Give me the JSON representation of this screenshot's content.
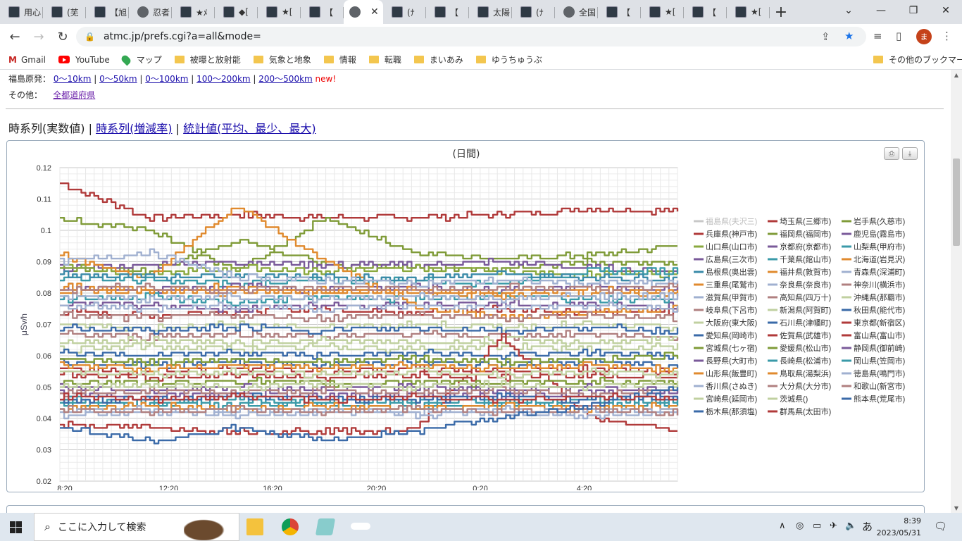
{
  "browser": {
    "tabs": [
      {
        "label": "用心",
        "icon": "ms-icon"
      },
      {
        "label": "(芜",
        "icon": "ms-icon"
      },
      {
        "label": "【旭",
        "icon": "ms-icon"
      },
      {
        "label": "忍者",
        "icon": "globe-icon"
      },
      {
        "label": "★ﾒ",
        "icon": "ms-icon"
      },
      {
        "label": "◆[",
        "icon": "ms-icon"
      },
      {
        "label": "★[",
        "icon": "ms-icon"
      },
      {
        "label": "【",
        "icon": "ms-icon"
      },
      {
        "label": "",
        "icon": "globe-icon",
        "active": true
      },
      {
        "label": "(ﾅ",
        "icon": "ms-icon"
      },
      {
        "label": "【",
        "icon": "ms-icon"
      },
      {
        "label": "太陽",
        "icon": "ms-icon"
      },
      {
        "label": "(ﾅ",
        "icon": "ms-icon"
      },
      {
        "label": "全国",
        "icon": "globe-icon"
      },
      {
        "label": "【",
        "icon": "ms-icon"
      },
      {
        "label": "★[",
        "icon": "ms-icon"
      },
      {
        "label": "【",
        "icon": "ms-icon"
      },
      {
        "label": "★[",
        "icon": "ms-icon"
      }
    ],
    "url": "atmc.jp/prefs.cgi?a=all&mode=",
    "profile_initial": "ま",
    "bookmarks": [
      "Gmail",
      "YouTube",
      "マップ",
      "被曝と放射能",
      "気象と地象",
      "情報",
      "転職",
      "まいあみ",
      "ゆうちゅうぶ"
    ],
    "other_bookmarks": "その他のブックマーク"
  },
  "page": {
    "fukushima_label": "福島原発：",
    "fukushima_links": [
      "0～10km",
      "0～50km",
      "0～100km",
      "100～200km",
      "200～500km"
    ],
    "new_label": "new!",
    "other_label": "その他：",
    "other_link": "全都道府県",
    "view_current": "時系列(実数値)",
    "view_links": [
      "時系列(増減率)",
      "統計値(平均、最少、最大)"
    ]
  },
  "chart_data": {
    "type": "line",
    "title": "(日間)",
    "ylabel": "μSv/h",
    "ylim": [
      0.02,
      0.12
    ],
    "yticks": [
      "0.02",
      "0.03",
      "0.04",
      "0.05",
      "0.06",
      "0.07",
      "0.08",
      "0.09",
      "0.1",
      "0.11",
      "0.12"
    ],
    "x": [
      "8:20",
      "12:20",
      "16:20",
      "20:20",
      "0:20",
      "4:20"
    ],
    "series": [
      {
        "name": "福島県(夫沢三)",
        "color": "#c8c8c8",
        "values": []
      },
      {
        "name": "埼玉県(三郷市)",
        "color": "#b03a3a",
        "values": [
          0.115,
          0.104,
          0.105,
          0.104,
          0.104,
          0.105,
          0.107,
          0.106
        ]
      },
      {
        "name": "岩手県(久慈市)",
        "color": "#7f9b38",
        "values": [
          0.104,
          0.1,
          0.087,
          0.104,
          0.093,
          0.091,
          0.092,
          0.095
        ]
      },
      {
        "name": "兵庫県(神戸市)",
        "color": "#b03a3a",
        "values": [
          0.074,
          0.073,
          0.074,
          0.075,
          0.074,
          0.075,
          0.074,
          0.074
        ]
      },
      {
        "name": "福岡県(福岡市)",
        "color": "#7f9b38",
        "values": [
          0.088,
          0.087,
          0.097,
          0.089,
          0.088,
          0.088,
          0.09,
          0.089
        ]
      },
      {
        "name": "鹿児島(霧島市)",
        "color": "#7a5a9a",
        "values": [
          0.088,
          0.089,
          0.09,
          0.089,
          0.089,
          0.09,
          0.088,
          0.087
        ]
      },
      {
        "name": "山口県(山口市)",
        "color": "#8aa83e",
        "values": [
          0.089,
          0.086,
          0.088,
          0.087,
          0.088,
          0.087,
          0.086,
          0.086
        ]
      },
      {
        "name": "京都府(京都市)",
        "color": "#7a5a9a",
        "values": [
          0.077,
          0.076,
          0.075,
          0.076,
          0.076,
          0.077,
          0.076,
          0.076
        ]
      },
      {
        "name": "山梨県(甲府市)",
        "color": "#3a9aa8",
        "values": [
          0.085,
          0.084,
          0.083,
          0.084,
          0.084,
          0.083,
          0.087,
          0.087
        ]
      },
      {
        "name": "広島県(三次市)",
        "color": "#7a5a9a",
        "values": [
          0.082,
          0.081,
          0.082,
          0.081,
          0.082,
          0.081,
          0.082,
          0.081
        ]
      },
      {
        "name": "千葉県(館山市)",
        "color": "#3a9aa8",
        "values": [
          0.078,
          0.079,
          0.077,
          0.079,
          0.078,
          0.079,
          0.078,
          0.078
        ]
      },
      {
        "name": "北海道(岩見沢)",
        "color": "#e08a2e",
        "values": [
          0.092,
          0.085,
          0.108,
          0.09,
          0.076,
          0.072,
          0.074,
          0.075
        ]
      },
      {
        "name": "島根県(奥出雲)",
        "color": "#3a8aa8",
        "values": [
          0.086,
          0.085,
          0.086,
          0.085,
          0.085,
          0.086,
          0.085,
          0.085
        ]
      },
      {
        "name": "福井県(敦賀市)",
        "color": "#e08a2e",
        "values": [
          0.082,
          0.081,
          0.082,
          0.08,
          0.081,
          0.08,
          0.081,
          0.08
        ]
      },
      {
        "name": "青森県(深浦町)",
        "color": "#a0b0d0",
        "values": [
          0.09,
          0.093,
          0.085,
          0.084,
          0.083,
          0.084,
          0.083,
          0.083
        ]
      },
      {
        "name": "三重県(尾鷲市)",
        "color": "#e08a2e",
        "values": [
          0.08,
          0.081,
          0.08,
          0.081,
          0.08,
          0.079,
          0.08,
          0.08
        ]
      },
      {
        "name": "奈良県(奈良市)",
        "color": "#a0b0d0",
        "values": [
          0.079,
          0.078,
          0.079,
          0.078,
          0.079,
          0.078,
          0.079,
          0.079
        ]
      },
      {
        "name": "神奈川(横浜市)",
        "color": "#b08080",
        "values": [
          0.081,
          0.082,
          0.081,
          0.082,
          0.081,
          0.082,
          0.081,
          0.082
        ]
      },
      {
        "name": "滋賀県(甲賀市)",
        "color": "#a0b0d0",
        "values": [
          0.076,
          0.075,
          0.076,
          0.075,
          0.076,
          0.075,
          0.076,
          0.075
        ]
      },
      {
        "name": "高知県(四万十)",
        "color": "#b08080",
        "values": [
          0.073,
          0.072,
          0.073,
          0.072,
          0.073,
          0.072,
          0.073,
          0.072
        ]
      },
      {
        "name": "沖縄県(那覇市)",
        "color": "#c0d0a0",
        "values": [
          0.07,
          0.069,
          0.07,
          0.069,
          0.07,
          0.069,
          0.07,
          0.069
        ]
      },
      {
        "name": "岐阜県(下呂市)",
        "color": "#b08080",
        "values": [
          0.067,
          0.066,
          0.067,
          0.066,
          0.067,
          0.066,
          0.067,
          0.066
        ]
      },
      {
        "name": "新潟県(阿賀町)",
        "color": "#c0d0a0",
        "values": [
          0.064,
          0.065,
          0.064,
          0.065,
          0.064,
          0.065,
          0.064,
          0.065
        ]
      },
      {
        "name": "秋田県(能代市)",
        "color": "#3a6aa8",
        "values": [
          0.069,
          0.068,
          0.069,
          0.068,
          0.069,
          0.068,
          0.069,
          0.068
        ]
      },
      {
        "name": "大阪府(東大阪)",
        "color": "#c0d0a0",
        "values": [
          0.062,
          0.063,
          0.062,
          0.063,
          0.062,
          0.063,
          0.062,
          0.063
        ]
      },
      {
        "name": "石川県(津幡町)",
        "color": "#3a6aa8",
        "values": [
          0.061,
          0.06,
          0.061,
          0.06,
          0.061,
          0.06,
          0.061,
          0.06
        ]
      },
      {
        "name": "東京都(新宿区)",
        "color": "#b03a3a",
        "values": [
          0.038,
          0.037,
          0.036,
          0.036,
          0.036,
          0.066,
          0.04,
          0.036
        ]
      },
      {
        "name": "愛知県(岡崎市)",
        "color": "#3a6aa8",
        "values": [
          0.058,
          0.057,
          0.058,
          0.057,
          0.058,
          0.057,
          0.058,
          0.057
        ]
      },
      {
        "name": "佐賀県(武雄市)",
        "color": "#b03a3a",
        "values": [
          0.056,
          0.055,
          0.056,
          0.055,
          0.056,
          0.055,
          0.056,
          0.055
        ]
      },
      {
        "name": "富山県(富山市)",
        "color": "#b03a3a",
        "values": [
          0.054,
          0.053,
          0.054,
          0.053,
          0.054,
          0.053,
          0.054,
          0.053
        ]
      },
      {
        "name": "宮城県(七ヶ宿)",
        "color": "#7f9b38",
        "values": [
          0.059,
          0.058,
          0.059,
          0.058,
          0.059,
          0.058,
          0.059,
          0.06
        ]
      },
      {
        "name": "愛媛県(松山市)",
        "color": "#7f9b38",
        "values": [
          0.052,
          0.051,
          0.052,
          0.051,
          0.052,
          0.051,
          0.052,
          0.051
        ]
      },
      {
        "name": "静岡県(御前崎)",
        "color": "#7a5a9a",
        "values": [
          0.05,
          0.049,
          0.05,
          0.049,
          0.05,
          0.049,
          0.05,
          0.049
        ]
      },
      {
        "name": "長野県(大町市)",
        "color": "#7a5a9a",
        "values": [
          0.048,
          0.047,
          0.048,
          0.047,
          0.048,
          0.047,
          0.048,
          0.047
        ]
      },
      {
        "name": "長崎県(松浦市)",
        "color": "#3a9aa8",
        "values": [
          0.046,
          0.045,
          0.046,
          0.045,
          0.046,
          0.045,
          0.046,
          0.045
        ]
      },
      {
        "name": "岡山県(笠岡市)",
        "color": "#3a9aa8",
        "values": [
          0.044,
          0.045,
          0.044,
          0.045,
          0.044,
          0.045,
          0.044,
          0.045
        ]
      },
      {
        "name": "山形県(飯豊町)",
        "color": "#e08a2e",
        "values": [
          0.057,
          0.056,
          0.057,
          0.056,
          0.057,
          0.056,
          0.057,
          0.056
        ]
      },
      {
        "name": "鳥取県(湯梨浜)",
        "color": "#e08a2e",
        "values": [
          0.043,
          0.044,
          0.043,
          0.044,
          0.043,
          0.044,
          0.043,
          0.044
        ]
      },
      {
        "name": "徳島県(鳴門市)",
        "color": "#a0b0d0",
        "values": [
          0.042,
          0.043,
          0.042,
          0.043,
          0.042,
          0.043,
          0.042,
          0.043
        ]
      },
      {
        "name": "香川県(さぬき)",
        "color": "#a0b0d0",
        "values": [
          0.041,
          0.042,
          0.041,
          0.042,
          0.041,
          0.042,
          0.041,
          0.042
        ]
      },
      {
        "name": "大分県(大分市)",
        "color": "#b08080",
        "values": [
          0.043,
          0.042,
          0.043,
          0.042,
          0.043,
          0.042,
          0.043,
          0.042
        ]
      },
      {
        "name": "和歌山(新宮市)",
        "color": "#b08080",
        "values": [
          0.048,
          0.049,
          0.048,
          0.049,
          0.048,
          0.049,
          0.048,
          0.049
        ]
      },
      {
        "name": "宮崎県(延岡市)",
        "color": "#c0d0a0",
        "values": [
          0.055,
          0.054,
          0.055,
          0.054,
          0.055,
          0.054,
          0.055,
          0.054
        ]
      },
      {
        "name": "茨城県()",
        "color": "#c0d0a0",
        "values": [
          0.05,
          0.051,
          0.05,
          0.051,
          0.05,
          0.051,
          0.05,
          0.051
        ]
      },
      {
        "name": "熊本県(荒尾市)",
        "color": "#3a6aa8",
        "values": [
          0.037,
          0.033,
          0.037,
          0.033,
          0.036,
          0.04,
          0.044,
          0.05
        ]
      },
      {
        "name": "栃木県(那須塩)",
        "color": "#3a6aa8",
        "values": [
          0.046,
          0.046,
          0.047,
          0.046,
          0.046,
          0.047,
          0.046,
          0.047
        ]
      },
      {
        "name": "群馬県(太田市)",
        "color": "#b03a3a",
        "values": [
          0.047,
          0.046,
          0.047,
          0.046,
          0.047,
          0.046,
          0.047,
          0.046
        ]
      }
    ]
  },
  "taskbar": {
    "search_placeholder": "ここに入力して検索",
    "time": "8:39",
    "date": "2023/05/31",
    "ime": "あ"
  }
}
